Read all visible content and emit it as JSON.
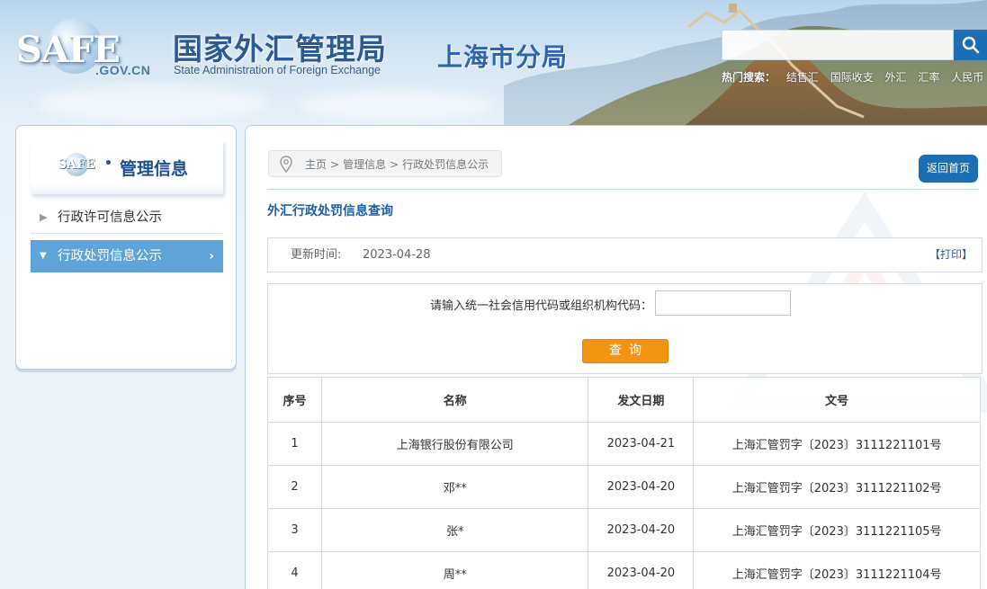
{
  "header": {
    "logo_text": "SAFE",
    "logo_domain": ".GOV.CN",
    "agency_cn": "国家外汇管理局",
    "agency_en": "State Administration of Foreign Exchange",
    "branch": "上海市分局",
    "search_placeholder": "",
    "hot_search_label": "热门搜索：",
    "hot_search_items": [
      "结售汇",
      "国际收支",
      "外汇",
      "汇率",
      "人民币"
    ]
  },
  "sidebar": {
    "title": "管理信息",
    "logo_text": "SAFE",
    "items": [
      {
        "label": "行政许可信息公示",
        "active": false
      },
      {
        "label": "行政处罚信息公示",
        "active": true
      }
    ]
  },
  "main": {
    "breadcrumb": [
      "主页",
      "管理信息",
      "行政处罚信息公示"
    ],
    "breadcrumb_sep": ">",
    "home_button": "返回首页",
    "section_title": "外汇行政处罚信息查询",
    "update_label": "更新时间:",
    "update_value": "2023-04-28",
    "print_label": "【打印】",
    "query_label": "请输入统一社会信用代码或组织机构代码：",
    "query_value": "",
    "query_button": "查询",
    "table": {
      "headers": [
        "序号",
        "名称",
        "发文日期",
        "文号"
      ],
      "rows": [
        [
          "1",
          "上海银行股份有限公司",
          "2023-04-21",
          "上海汇管罚字〔2023〕3111221101号"
        ],
        [
          "2",
          "邓**",
          "2023-04-20",
          "上海汇管罚字〔2023〕3111221102号"
        ],
        [
          "3",
          "张*",
          "2023-04-20",
          "上海汇管罚字〔2023〕3111221105号"
        ],
        [
          "4",
          "周**",
          "2023-04-20",
          "上海汇管罚字〔2023〕3111221104号"
        ]
      ]
    }
  },
  "colors": {
    "brand_blue": "#1d6db4",
    "title_blue": "#1e5fa8",
    "sidebar_active": "#5fa3d9",
    "query_orange": "#f39412"
  }
}
